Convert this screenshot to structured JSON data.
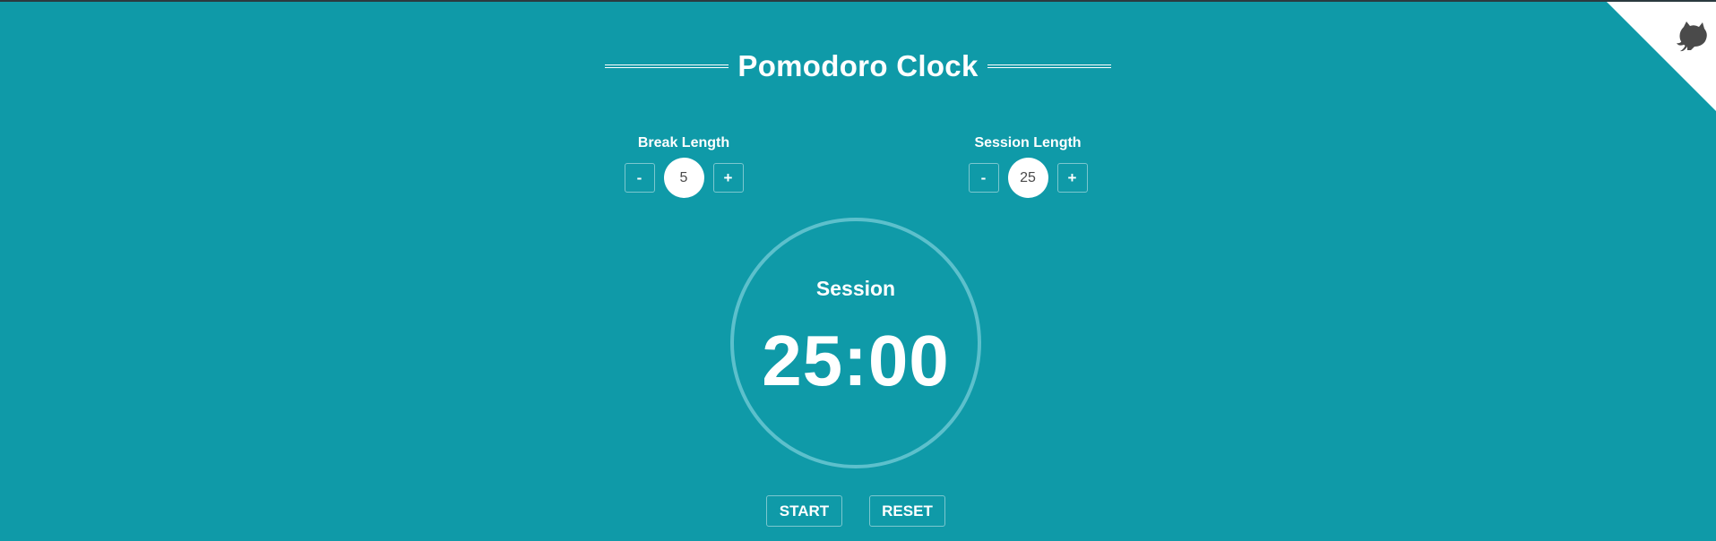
{
  "header": {
    "title": "Pomodoro Clock"
  },
  "break": {
    "label": "Break Length",
    "decrement": "-",
    "value": "5",
    "increment": "+"
  },
  "session": {
    "label": "Session Length",
    "decrement": "-",
    "value": "25",
    "increment": "+"
  },
  "clock": {
    "label": "Session",
    "time": "25:00"
  },
  "actions": {
    "start": "START",
    "reset": "RESET"
  },
  "corner": {
    "icon": "github-octocat-icon"
  },
  "colors": {
    "background": "#0f9aa8",
    "ring": "#5cc0cc",
    "text": "#ffffff",
    "value_text": "#4a4a4a",
    "octocat": "#4a4a4a"
  }
}
